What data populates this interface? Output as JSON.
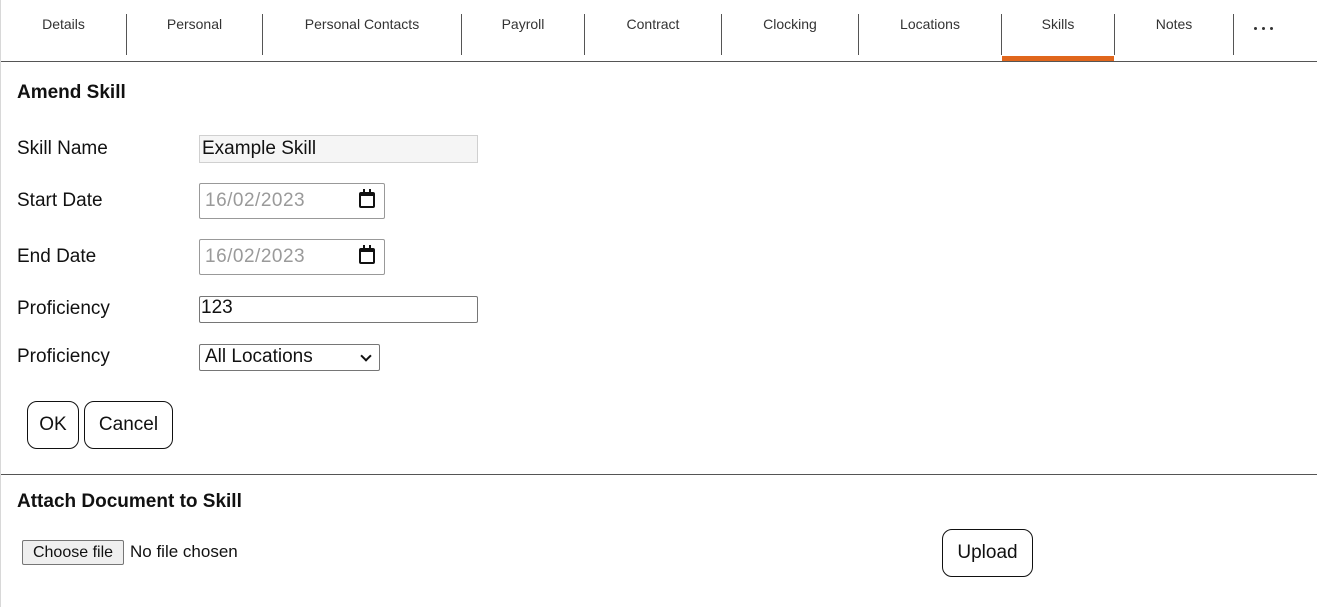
{
  "tabs": [
    {
      "label": "Details"
    },
    {
      "label": "Personal"
    },
    {
      "label": "Personal Contacts"
    },
    {
      "label": "Payroll"
    },
    {
      "label": "Contract"
    },
    {
      "label": "Clocking"
    },
    {
      "label": "Locations"
    },
    {
      "label": "Skills",
      "active": true
    },
    {
      "label": "Notes"
    }
  ],
  "more_icon": "ellipsis-icon",
  "accent_color": "#e0661c",
  "amend": {
    "title": "Amend Skill",
    "skill_name_label": "Skill Name",
    "skill_name_value": "Example Skill",
    "start_date_label": "Start Date",
    "start_date_value": "16/02/2023",
    "end_date_label": "End Date",
    "end_date_value": "16/02/2023",
    "proficiency_label": "Proficiency",
    "proficiency_value": "123",
    "location_label": "Proficiency",
    "location_selected": "All Locations",
    "calendar_icon": "calendar-icon",
    "ok_label": "OK",
    "cancel_label": "Cancel"
  },
  "attach": {
    "title": "Attach Document to Skill",
    "choose_file_label": "Choose file",
    "no_file_text": "No file chosen",
    "upload_label": "Upload"
  }
}
